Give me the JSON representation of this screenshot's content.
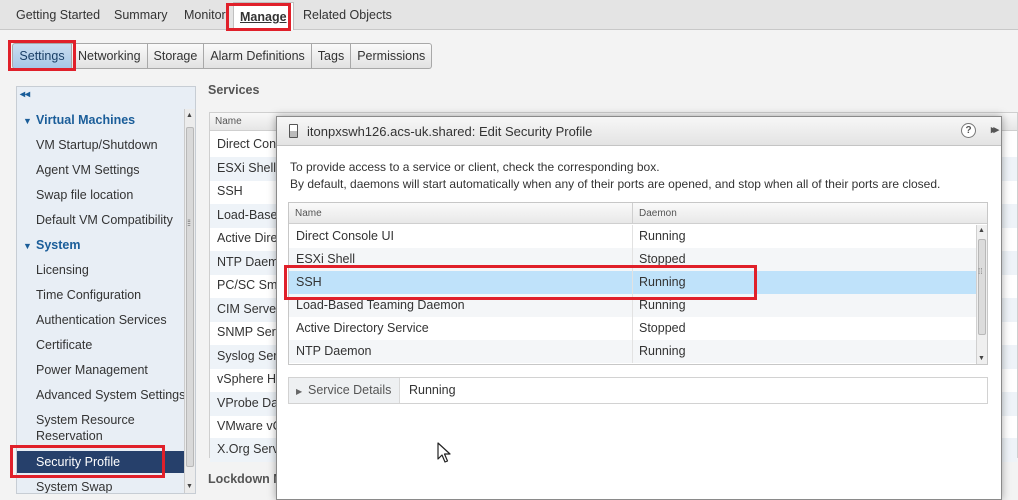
{
  "top_tabs": [
    "Getting Started",
    "Summary",
    "Monitor",
    "Manage",
    "Related Objects"
  ],
  "sub_tabs": [
    "Settings",
    "Networking",
    "Storage",
    "Alarm Definitions",
    "Tags",
    "Permissions"
  ],
  "leftnav": {
    "collapse_icon": "double-chevron-left-icon",
    "items": [
      {
        "label": "Virtual Machines",
        "type": "group"
      },
      {
        "label": "VM Startup/Shutdown",
        "type": "item"
      },
      {
        "label": "Agent VM Settings",
        "type": "item"
      },
      {
        "label": "Swap file location",
        "type": "item"
      },
      {
        "label": "Default VM Compatibility",
        "type": "item"
      },
      {
        "label": "System",
        "type": "group"
      },
      {
        "label": "Licensing",
        "type": "item"
      },
      {
        "label": "Time Configuration",
        "type": "item"
      },
      {
        "label": "Authentication Services",
        "type": "item"
      },
      {
        "label": "Certificate",
        "type": "item"
      },
      {
        "label": "Power Management",
        "type": "item"
      },
      {
        "label": "Advanced System Settings",
        "type": "item"
      },
      {
        "label": "System Resource Reservation",
        "type": "item"
      },
      {
        "label": "Security Profile",
        "type": "item",
        "selected": true
      },
      {
        "label": "System Swap",
        "type": "item"
      }
    ]
  },
  "services_panel": {
    "title": "Services",
    "header": "Name",
    "rows": [
      "Direct Con",
      "ESXi Shell",
      "SSH",
      "Load-Base",
      "Active Direc",
      "NTP Daem",
      "PC/SC Sm",
      "CIM Server",
      "SNMP Serv",
      "Syslog Ser",
      "vSphere Hi",
      "VProbe Da",
      "VMware vC",
      "X.Org Serve"
    ],
    "lockdown": "Lockdown M"
  },
  "dialog": {
    "title": "itonpxswh126.acs-uk.shared: Edit Security Profile",
    "help": "?",
    "instructions": [
      "To provide access to a service or client, check the corresponding box.",
      "By default, daemons will start automatically when any of their ports are opened, and stop when all of their ports are closed."
    ],
    "table": {
      "col_name": "Name",
      "col_daemon": "Daemon",
      "rows": [
        {
          "name": "Direct Console UI",
          "daemon": "Running"
        },
        {
          "name": "ESXi Shell",
          "daemon": "Stopped"
        },
        {
          "name": "SSH",
          "daemon": "Running",
          "selected": true
        },
        {
          "name": "Load-Based Teaming Daemon",
          "daemon": "Running"
        },
        {
          "name": "Active Directory Service",
          "daemon": "Stopped"
        },
        {
          "name": "NTP Daemon",
          "daemon": "Running"
        }
      ]
    },
    "details": {
      "label": "Service Details",
      "value": "Running"
    }
  },
  "colors": {
    "highlight": "#e0202a",
    "selected_row": "#bfe2fa",
    "selected_nav": "#26406b",
    "link_blue": "#1a5d99"
  }
}
